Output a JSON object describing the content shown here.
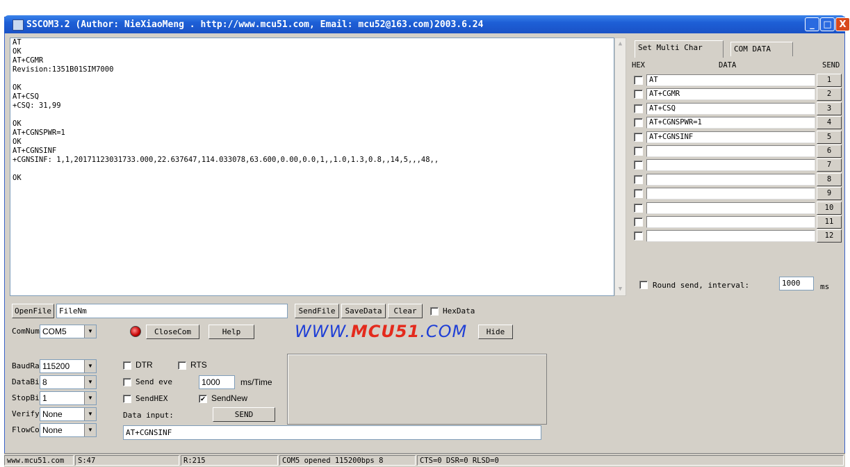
{
  "window": {
    "title": "SSCOM3.2 (Author: NieXiaoMeng .  http://www.mcu51.com,  Email: mcu52@163.com)2003.6.24",
    "controls": {
      "minimize": "_",
      "maximize": "□",
      "close": "X"
    }
  },
  "log": {
    "lines": [
      "AT",
      "OK",
      "AT+CGMR",
      "Revision:1351B01SIM7000",
      "",
      "OK",
      "AT+CSQ",
      "+CSQ: 31,99",
      "",
      "OK",
      "AT+CGNSPWR=1",
      "OK",
      "AT+CGNSINF",
      "+CGNSINF: 1,1,20171123031733.000,22.637647,114.033078,63.600,0.00,0.0,1,,1.0,1.3,0.8,,14,5,,,48,,",
      "",
      "OK"
    ]
  },
  "multi": {
    "tabs": [
      "Set Multi Char",
      "COM DATA"
    ],
    "headers": {
      "hex": "HEX",
      "data": "DATA",
      "send": "SEND"
    },
    "rows": [
      {
        "data": "AT",
        "send": "1"
      },
      {
        "data": "AT+CGMR",
        "send": "2"
      },
      {
        "data": "AT+CSQ",
        "send": "3"
      },
      {
        "data": "AT+CGNSPWR=1",
        "send": "4"
      },
      {
        "data": "AT+CGNSINF",
        "send": "5"
      },
      {
        "data": "",
        "send": "6"
      },
      {
        "data": "",
        "send": "7"
      },
      {
        "data": "",
        "send": "8"
      },
      {
        "data": "",
        "send": "9"
      },
      {
        "data": "",
        "send": "10"
      },
      {
        "data": "",
        "send": "11"
      },
      {
        "data": "",
        "send": "12"
      }
    ],
    "round_send_label": "Round send, interval:",
    "interval": "1000",
    "interval_unit": "ms"
  },
  "toolbar1": {
    "openfile": "OpenFile",
    "filename": "FileNm",
    "sendfile": "SendFile",
    "savedata": "SaveData",
    "clear": "Clear",
    "hexdata": "HexData"
  },
  "toolbar2": {
    "comnum_label": "ComNum",
    "comnum_value": "COM5",
    "closecom": "CloseCom",
    "help": "Help",
    "logo_a": "WWW.",
    "logo_b": "MCU51",
    "logo_c": ".COM",
    "hide": "Hide"
  },
  "settings": {
    "baud_label": "BaudRa",
    "baud_value": "115200",
    "databits_label": "DataBi",
    "databits_value": "8",
    "stopbits_label": "StopBi",
    "stopbits_value": "1",
    "verify_label": "Verifyl",
    "verify_value": "None",
    "flow_label": "FlowCo",
    "flow_value": "None",
    "dtr": "DTR",
    "rts": "RTS",
    "send_every": "Send eve",
    "every_value": "1000",
    "every_unit": "ms/Time",
    "sendhex": "SendHEX",
    "sendnew": "SendNew",
    "data_input": "Data input:",
    "send_button": "SEND",
    "input_value": "AT+CGNSINF"
  },
  "status": {
    "site": "www.mcu51.com",
    "s": "S:47",
    "r": "R:215",
    "com": "COM5 opened 115200bps  8",
    "lines": "CTS=0 DSR=0 RLSD=0"
  }
}
